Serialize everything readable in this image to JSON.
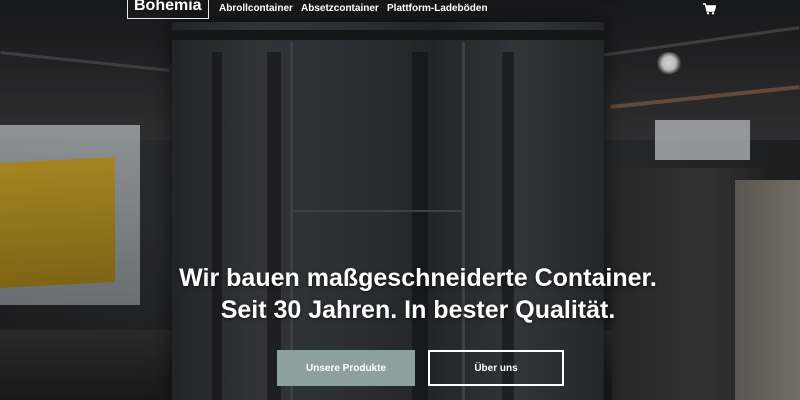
{
  "header": {
    "logo": "Bohemia",
    "nav": [
      {
        "label": "Abrollcontainer"
      },
      {
        "label": "Absetzcontainer"
      },
      {
        "label": "Plattform-Ladeböden"
      }
    ],
    "cart_icon": "shopping-cart-icon"
  },
  "hero": {
    "headline_line1": "Wir bauen maßgeschneiderte Container.",
    "headline_line2": "Seit 30 Jahren. In bester Qualität.",
    "primary_button": "Unsere Produkte",
    "secondary_button": "Über uns"
  },
  "colors": {
    "primary_button": "#8e9fa0",
    "text": "#ffffff"
  }
}
